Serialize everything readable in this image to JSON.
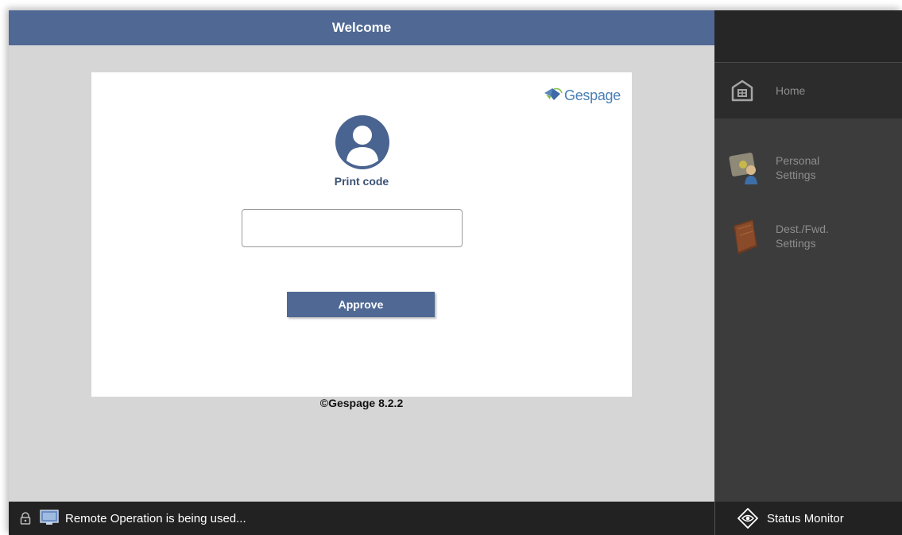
{
  "header": {
    "title": "Welcome"
  },
  "login_card": {
    "logo_text": "Gespage",
    "print_code_label": "Print code",
    "code_input": {
      "value": "",
      "placeholder": ""
    },
    "approve_label": "Approve"
  },
  "footer": {
    "copyright": "©Gespage 8.2.2"
  },
  "side_menu": {
    "home_label": "Home",
    "items": [
      {
        "line1": "Personal",
        "line2": "Settings",
        "icon": "personal-settings-icon"
      },
      {
        "line1": "Dest./Fwd.",
        "line2": "Settings",
        "icon": "address-book-icon"
      }
    ]
  },
  "status_bar": {
    "remote_text": "Remote Operation is being used...",
    "status_monitor_label": "Status Monitor"
  },
  "colors": {
    "accent": "#506994",
    "background": "#d6d6d6",
    "side_panel": "#3c3c3c",
    "status_bar": "#222222"
  }
}
